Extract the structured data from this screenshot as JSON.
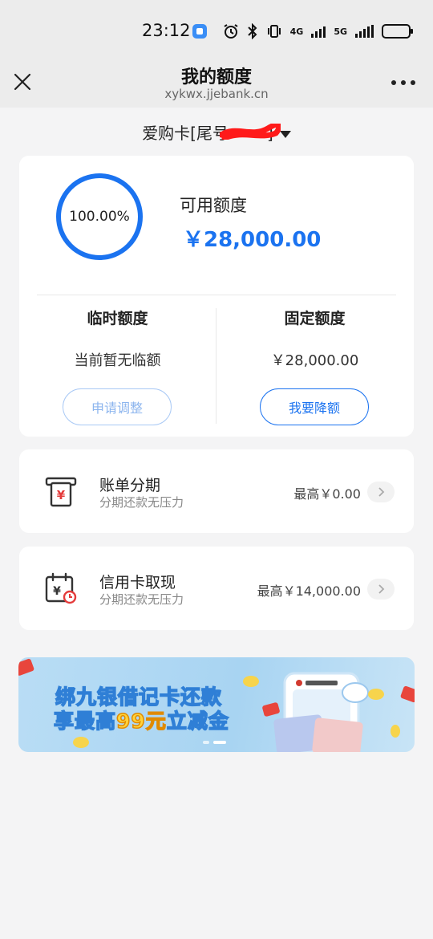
{
  "status": {
    "time": "23:12",
    "net1": "4G",
    "net2": "5G"
  },
  "nav": {
    "title": "我的额度",
    "subtitle": "xykwx.jjebank.cn"
  },
  "card_selector": {
    "label": "爱购卡[尾号",
    "suffix": "]"
  },
  "limit": {
    "ring_percent": "100.00%",
    "available_label": "可用额度",
    "available_amount": "￥28,000.00",
    "temp_title": "临时额度",
    "temp_value": "当前暂无临额",
    "temp_button": "申请调整",
    "fixed_title": "固定额度",
    "fixed_value": "￥28,000.00",
    "fixed_button": "我要降额"
  },
  "items": [
    {
      "title": "账单分期",
      "subtitle": "分期还款无压力",
      "right": "最高￥0.00"
    },
    {
      "title": "信用卡取现",
      "subtitle": "分期还款无压力",
      "right": "最高￥14,000.00"
    }
  ],
  "banner": {
    "line1": "绑九银借记卡还款",
    "line2_pre": "享最高",
    "line2_hl": "99元",
    "line2_post": "立减金"
  },
  "colors": {
    "accent": "#1b73f0",
    "background": "#f4f4f5"
  }
}
